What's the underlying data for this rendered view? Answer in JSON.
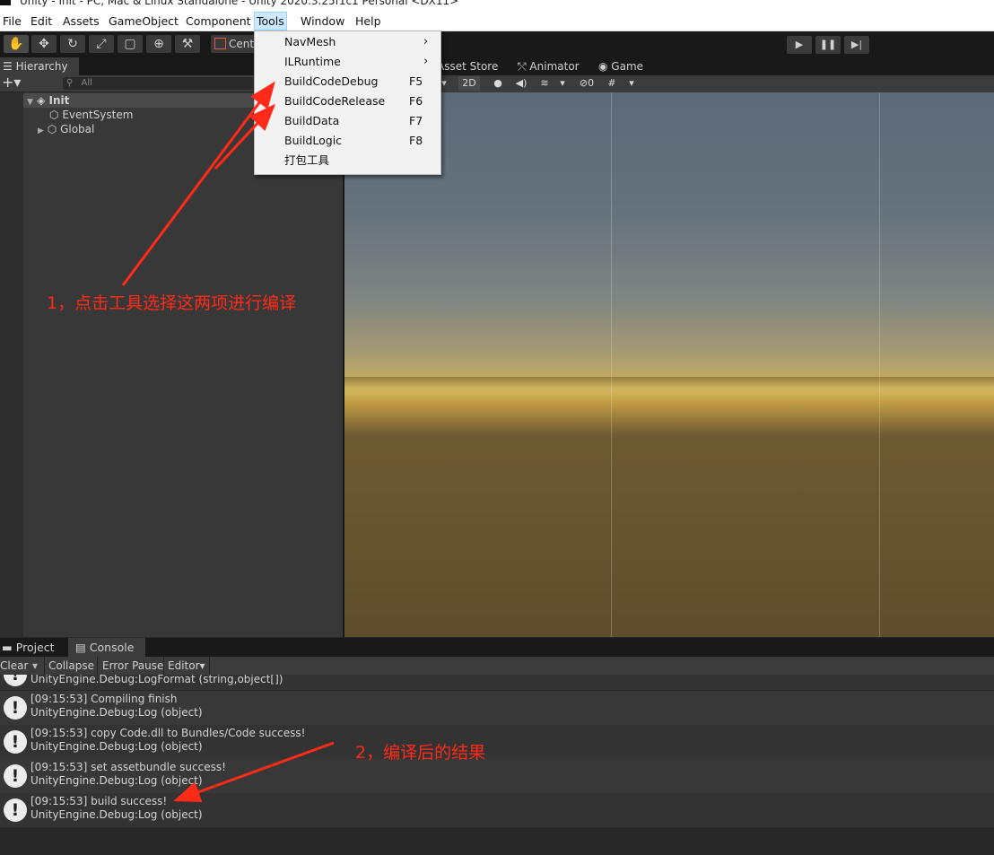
{
  "titlebar": {
    "text": "Unity - Init - PC, Mac & Linux Standalone - Unity 2020.3.25f1c1 Personal <DX11>"
  },
  "menubar": {
    "items": [
      "File",
      "Edit",
      "Assets",
      "GameObject",
      "Component",
      "Tools",
      "Window",
      "Help"
    ],
    "active": "Tools"
  },
  "toolbar": {
    "pivot_label": "Cent"
  },
  "tools_menu": {
    "items": [
      {
        "label": "NavMesh",
        "shortcut": "",
        "submenu": true
      },
      {
        "label": "ILRuntime",
        "shortcut": "",
        "submenu": true
      },
      {
        "label": "BuildCodeDebug",
        "shortcut": "F5",
        "submenu": false
      },
      {
        "label": "BuildCodeRelease",
        "shortcut": "F6",
        "submenu": false
      },
      {
        "label": "BuildData",
        "shortcut": "F7",
        "submenu": false
      },
      {
        "label": "BuildLogic",
        "shortcut": "F8",
        "submenu": false
      },
      {
        "label": "打包工具",
        "shortcut": "",
        "submenu": false
      }
    ]
  },
  "hierarchy": {
    "tab_label": "Hierarchy",
    "search_placeholder": "All",
    "scene_name": "Init",
    "objects": [
      "EventSystem",
      "Global"
    ]
  },
  "scene": {
    "tabs": [
      "Asset Store",
      "Animator",
      "Game"
    ],
    "mode_2d": "2D",
    "hidden_count": "0"
  },
  "bottom": {
    "tabs": [
      "Project",
      "Console"
    ],
    "console_toolbar": [
      "Clear",
      "Collapse",
      "Error Pause",
      "Editor"
    ],
    "logs": [
      {
        "message": "",
        "source": "UnityEngine.Debug:LogFormat (string,object[])"
      },
      {
        "message": "[09:15:53] Compiling finish",
        "source": "UnityEngine.Debug:Log (object)"
      },
      {
        "message": "[09:15:53] copy Code.dll to Bundles/Code success!",
        "source": "UnityEngine.Debug:Log (object)"
      },
      {
        "message": "[09:15:53] set assetbundle success!",
        "source": "UnityEngine.Debug:Log (object)"
      },
      {
        "message": "[09:15:53] build success!",
        "source": "UnityEngine.Debug:Log (object)"
      }
    ]
  },
  "annotations": {
    "step1": "1，点击工具选择这两项进行编译",
    "step2": "2，编译后的结果"
  },
  "colors": {
    "annotation": "#ff2a17",
    "menu_highlight": "#cce8ff"
  },
  "icons": [
    "unity-logo",
    "hand-icon",
    "move-icon",
    "rotate-icon",
    "scale-icon",
    "rect-icon",
    "transform-icon",
    "custom-tool-icon",
    "play-icon",
    "pause-icon",
    "step-icon",
    "unity-scene-icon",
    "gameobject-icon",
    "info-icon"
  ]
}
